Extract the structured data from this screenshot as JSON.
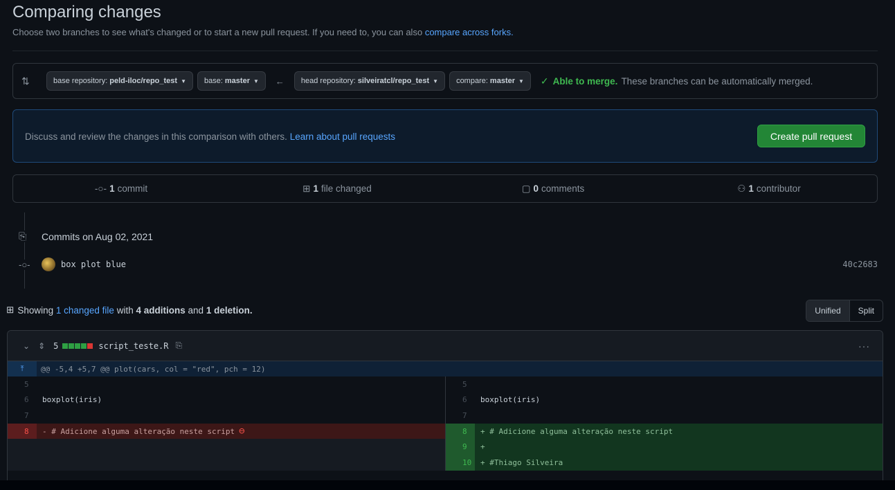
{
  "header": {
    "title": "Comparing changes",
    "subtitle": "Choose two branches to see what's changed or to start a new pull request. If you need to, you can also",
    "subtitle_link": "compare across forks."
  },
  "range": {
    "base_repo_label": "base repository:",
    "base_repo_value": "peld-iloc/repo_test",
    "base_label": "base:",
    "base_value": "master",
    "head_repo_label": "head repository:",
    "head_repo_value": "silveiratcl/repo_test",
    "compare_label": "compare:",
    "compare_value": "master",
    "merge_ok": "Able to merge.",
    "merge_msg": "These branches can be automatically merged."
  },
  "blankslate": {
    "text": "Discuss and review the changes in this comparison with others.",
    "link": "Learn about pull requests",
    "button": "Create pull request"
  },
  "numbers": {
    "commits_n": "1",
    "commits_label": "commit",
    "files_n": "1",
    "files_label": "file changed",
    "comments_n": "0",
    "comments_label": "comments",
    "contributors_n": "1",
    "contributors_label": "contributor"
  },
  "commits": {
    "heading": "Commits on Aug 02, 2021",
    "items": [
      {
        "message": "box plot blue",
        "sha": "40c2683"
      }
    ]
  },
  "toc": {
    "showing": "Showing",
    "changed_file": "1 changed file",
    "with": "with",
    "additions": "4 additions",
    "and": "and",
    "deletions": "1 deletion",
    "dot": ".",
    "unified": "Unified",
    "split": "Split"
  },
  "file": {
    "change_count": "5",
    "name": "script_teste.R",
    "hunk": "@@ -5,4 +5,7 @@ plot(cars, col = \"red\", pch = 12)",
    "left": [
      {
        "num": "5",
        "code": "",
        "type": "ctx"
      },
      {
        "num": "6",
        "code": "boxplot(iris)",
        "type": "ctx"
      },
      {
        "num": "7",
        "code": "",
        "type": "ctx"
      },
      {
        "num": "8",
        "code": "- # Adicione alguma alteração neste script",
        "type": "del"
      },
      {
        "num": "",
        "code": "",
        "type": "empty"
      },
      {
        "num": "",
        "code": "",
        "type": "empty"
      }
    ],
    "right": [
      {
        "num": "5",
        "code": "",
        "type": "ctx"
      },
      {
        "num": "6",
        "code": "boxplot(iris)",
        "type": "ctx"
      },
      {
        "num": "7",
        "code": "",
        "type": "ctx"
      },
      {
        "num": "8",
        "code": "+ # Adicione alguma alteração neste script",
        "type": "add"
      },
      {
        "num": "9",
        "code": "+",
        "type": "add"
      },
      {
        "num": "10",
        "code": "+ #Thiago Silveira",
        "type": "add"
      }
    ]
  },
  "colors": {
    "accent": "#58a6ff",
    "success": "#3fb950",
    "danger": "#f85149",
    "button_green": "#238636"
  }
}
